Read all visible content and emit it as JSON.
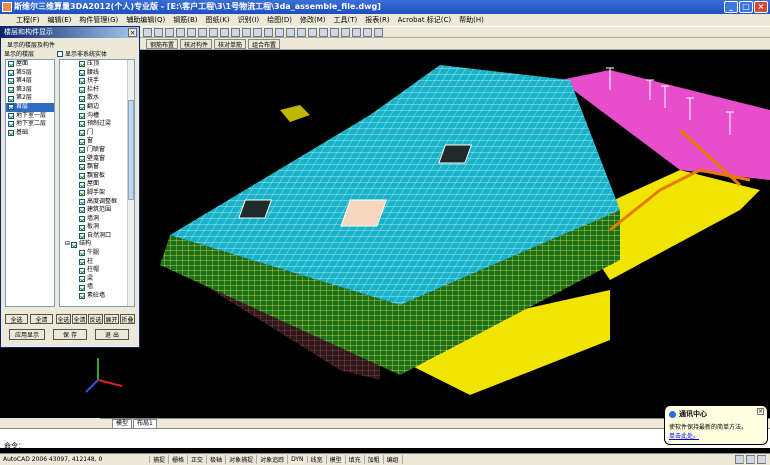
{
  "window": {
    "title": "斯维尔三维算量3DA2012(个人)专业版 - [E:\\客户工程\\3\\1号物流工程\\3da_assemble_file.dwg]"
  },
  "menu": [
    "工程(F)",
    "编辑(E)",
    "构件管理(G)",
    "辅助编辑(Q)",
    "钢筋(B)",
    "图纸(K)",
    "识别(I)",
    "绘图(D)",
    "修改(M)",
    "工具(T)",
    "报表(R)",
    "Acrobat 标记(C)",
    "帮助(H)"
  ],
  "toolbar2": [
    "钢筋布置",
    "核对构件",
    "核对单筋",
    "组合布置"
  ],
  "panel": {
    "title": "楼层和构件显示",
    "group_label": "显示的楼层及构件",
    "floors_label": "显示的楼层",
    "show_nonsys_label": "显示非系统实体",
    "floors": [
      {
        "name": "屋面",
        "checked": true,
        "selected": false
      },
      {
        "name": "第5层",
        "checked": true,
        "selected": false
      },
      {
        "name": "第4层",
        "checked": true,
        "selected": false
      },
      {
        "name": "第3层",
        "checked": true,
        "selected": false
      },
      {
        "name": "第2层",
        "checked": true,
        "selected": false
      },
      {
        "name": "首层",
        "checked": true,
        "selected": true
      },
      {
        "name": "地下室一层",
        "checked": true,
        "selected": false
      },
      {
        "name": "地下室二层",
        "checked": true,
        "selected": false
      },
      {
        "name": "基础",
        "checked": true,
        "selected": false
      }
    ],
    "components": [
      "压顶",
      "腰线",
      "扶手",
      "栏杆",
      "散水",
      "翻边",
      "沟槽",
      "预制过梁",
      "门",
      "窗",
      "门联窗",
      "壁龛窗",
      "飘窗",
      "飘窗板",
      "屋面",
      "脚手架",
      "高度调整框",
      "建筑范围",
      "墙洞",
      "板洞",
      "自然洞口"
    ],
    "struct_group": "结构",
    "struct_items": [
      "牛腿",
      "柱",
      "柱帽",
      "梁",
      "墙",
      "素砼墙"
    ],
    "btns_left": [
      "全选",
      "全清"
    ],
    "btns_right": [
      "全选",
      "全清",
      "反选",
      "展开",
      "折叠"
    ],
    "apply_label": "应用显示",
    "save_label": "保 存",
    "exit_label": "退 出"
  },
  "tabs": [
    "模型",
    "布局1"
  ],
  "command": {
    "prompt": "命令："
  },
  "status": {
    "coords": "AutoCAD 2006  43097,  412148, 0",
    "toggles": [
      "捕捉",
      "栅格",
      "正交",
      "极轴",
      "对象捕捉",
      "对象追踪",
      "DYN",
      "线宽",
      "模型",
      "填充",
      "加粗",
      "编组"
    ]
  },
  "balloon": {
    "title": "通讯中心",
    "text": "使软件保持最新的简单方法。",
    "link": "单击此处。"
  }
}
